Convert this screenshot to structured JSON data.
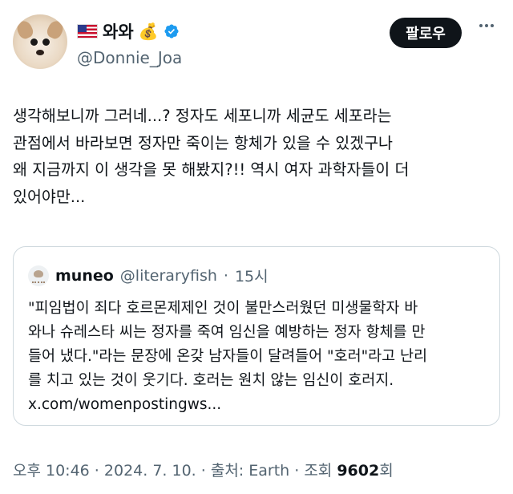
{
  "author": {
    "name": "와와",
    "flag_icon": "us-flag-icon",
    "emoji_icon": "money-bag-icon",
    "verified_color": "#1d9bf0",
    "handle": "@Donnie_Joa"
  },
  "header": {
    "follow_label": "팔로우"
  },
  "tweet": {
    "text": "생각해보니까 그러네...? 정자도 세포니까 세균도 세포라는\n관점에서 바라보면 정자만 죽이는 항체가 있을 수 있겠구나\n왜 지금까지 이 생각을 못 해봤지?!! 역시 여자 과학자들이 더\n있어야만..."
  },
  "quote": {
    "name": "muneo",
    "handle": "@literaryfish",
    "dot": "·",
    "time": "15시",
    "text": "\"피임법이 죄다 호르몬제제인 것이 불만스러웠던 미생물학자 바\n와나 슈레스타 씨는 정자를 죽여 임신을 예방하는 정자 항체를 만\n들어 냈다.\"라는 문장에 온갖 남자들이 달려들어 \"호러\"라고 난리\n를 치고 있는 것이 웃기다. 호러는 원치 않는 임신이 호러지.\nx.com/womenpostingws..."
  },
  "meta": {
    "time": "오후 10:46",
    "sep1": " · ",
    "date": "2024. 7. 10.",
    "sep2": " · ",
    "source_label": "출처: Earth",
    "sep3": " · ",
    "views_label": "조회 ",
    "views_count": "9602",
    "views_suffix": "회"
  }
}
